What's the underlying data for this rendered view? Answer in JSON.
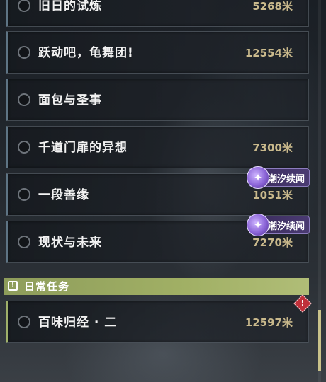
{
  "quests": [
    {
      "name": "旧日的试炼",
      "distance": "5268米"
    },
    {
      "name": "跃动吧，龟舞团!",
      "distance": "12554米"
    },
    {
      "name": "面包与圣事",
      "distance": ""
    },
    {
      "name": "千道门扉的异想",
      "distance": "7300米"
    },
    {
      "name": "一段善缘",
      "distance": "1051米",
      "tag": "潮汐续闻",
      "tag_icon": "swirl-icon"
    },
    {
      "name": "现状与未来",
      "distance": "7270米",
      "tag": "潮汐续闻",
      "tag_icon": "swirl-icon"
    }
  ],
  "daily_section": {
    "title": "日常任务",
    "icon": "exclamation-icon",
    "quests": [
      {
        "name": "百味归经 · 二",
        "distance": "12597米",
        "alert_icon": "alert-diamond-icon"
      }
    ]
  },
  "colors": {
    "distance": "#c9b98c",
    "daily_accent": "#a1b065",
    "tag_purple": "#8a63d6",
    "alert_red": "#c0303a",
    "scroll_thumb": "#c9c28a"
  }
}
